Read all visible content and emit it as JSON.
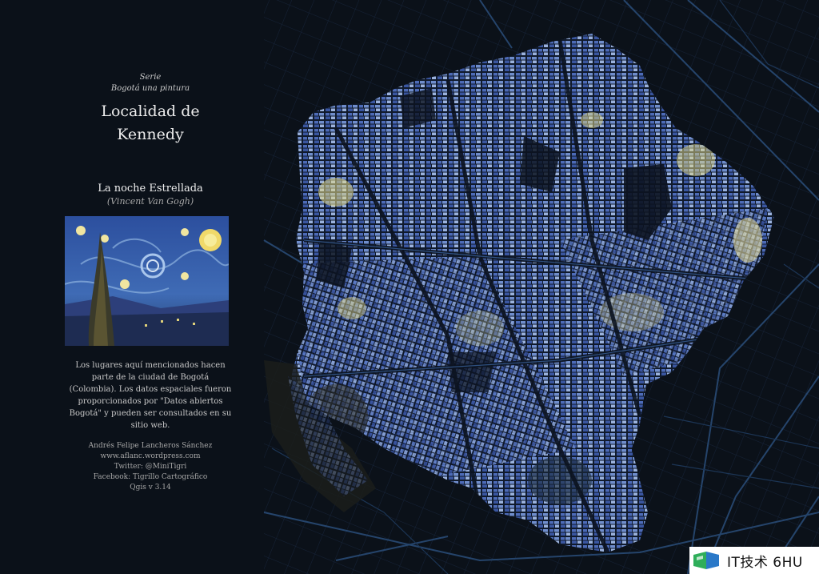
{
  "panel": {
    "serie_label": "Serie",
    "serie_name": "Bogotá una pintura",
    "title_line1": "Localidad de",
    "title_line2": "Kennedy",
    "painting_title": "La noche Estrellada",
    "painting_author": "(Vincent Van Gogh)",
    "description": "Los lugares aquí mencionados hacen parte de la ciudad de Bogotá (Colombia). Los datos espaciales fueron proporcionados por \"Datos abiertos Bogotá\" y pueden ser consultados en su sitio web.",
    "credits": [
      "Andrés Felipe Lancheros Sánchez",
      "www.aflanc.wordpress.com",
      "Twitter: @MiniTigri",
      "Facebook: Tigrillo Cartográfico",
      "Qgis v 3.14"
    ]
  },
  "watermark": {
    "text": "IT技术 6HU"
  },
  "colors": {
    "background": "#0b1119",
    "street_blue": "#1f3a5f",
    "block_blue": "#3b5bab",
    "block_light": "#8fa8d8",
    "star_yellow": "#e8de8a"
  }
}
